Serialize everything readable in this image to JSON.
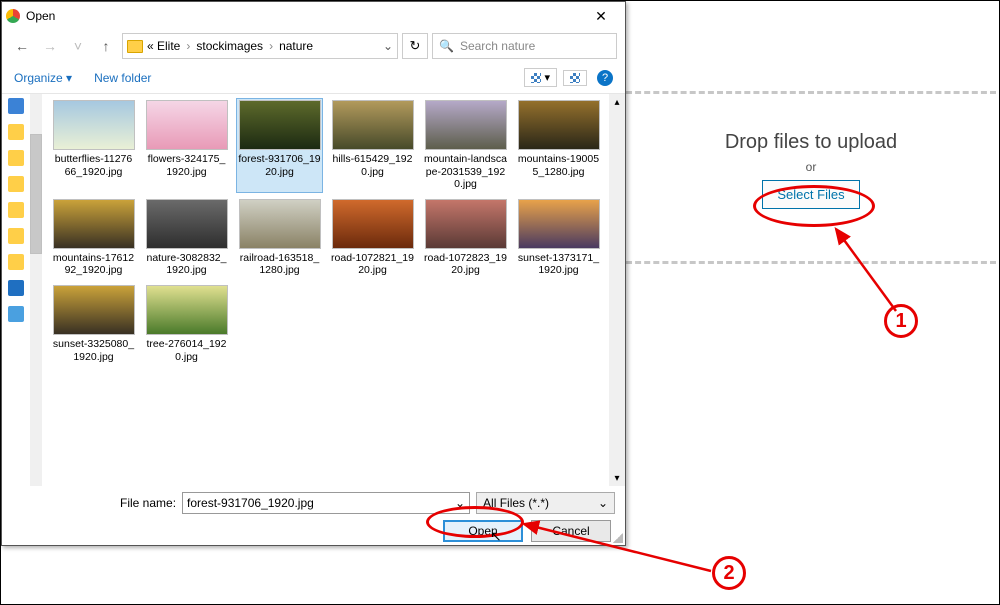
{
  "dialog": {
    "title": "Open",
    "breadcrumb": {
      "root": "«  Elite",
      "b1": "stockimages",
      "b2": "nature"
    },
    "search_placeholder": "Search nature",
    "toolbar": {
      "organize": "Organize ▾",
      "newfolder": "New folder"
    },
    "footer": {
      "file_name_label": "File name:",
      "file_name_value": "forest-931706_1920.jpg",
      "filter": "All Files (*.*)",
      "open": "Open",
      "cancel": "Cancel"
    }
  },
  "upload": {
    "title": "Drop files to upload",
    "or": "or",
    "button": "Select Files"
  },
  "annotations": {
    "one": "1",
    "two": "2"
  },
  "files": [
    {
      "name": "butterflies-1127666_1920.jpg",
      "bg": "linear-gradient(#a6c8e0,#e9f0d6)"
    },
    {
      "name": "flowers-324175_1920.jpg",
      "bg": "linear-gradient(#f5d6e6,#e89ab7)"
    },
    {
      "name": "forest-931706_1920.jpg",
      "bg": "linear-gradient(#5d6a2b,#1c2a12)",
      "selected": true
    },
    {
      "name": "hills-615429_1920.jpg",
      "bg": "linear-gradient(#b29a5c,#474a2a)"
    },
    {
      "name": "mountain-landscape-2031539_1920.jpg",
      "bg": "linear-gradient(#b5a9c8,#5d5e4c)"
    },
    {
      "name": "mountains-190055_1280.jpg",
      "bg": "linear-gradient(#94702c,#2a2718)"
    },
    {
      "name": "mountains-1761292_1920.jpg",
      "bg": "linear-gradient(#caa23a,#383023)"
    },
    {
      "name": "nature-3082832_1920.jpg",
      "bg": "linear-gradient(#6a6a6a,#2e2e2e)"
    },
    {
      "name": "railroad-163518_1280.jpg",
      "bg": "linear-gradient(#d0d0c4,#8a8265)"
    },
    {
      "name": "road-1072821_1920.jpg",
      "bg": "linear-gradient(#d06a2c,#6b2a0c)"
    },
    {
      "name": "road-1072823_1920.jpg",
      "bg": "linear-gradient(#c4766a,#5a3a36)"
    },
    {
      "name": "sunset-1373171_1920.jpg",
      "bg": "linear-gradient(#e8a24a,#4a3a60)"
    },
    {
      "name": "sunset-3325080_1920.jpg",
      "bg": "linear-gradient(#caa23a,#383023)"
    },
    {
      "name": "tree-276014_1920.jpg",
      "bg": "linear-gradient(#e0e090,#4a7a2a)"
    }
  ]
}
